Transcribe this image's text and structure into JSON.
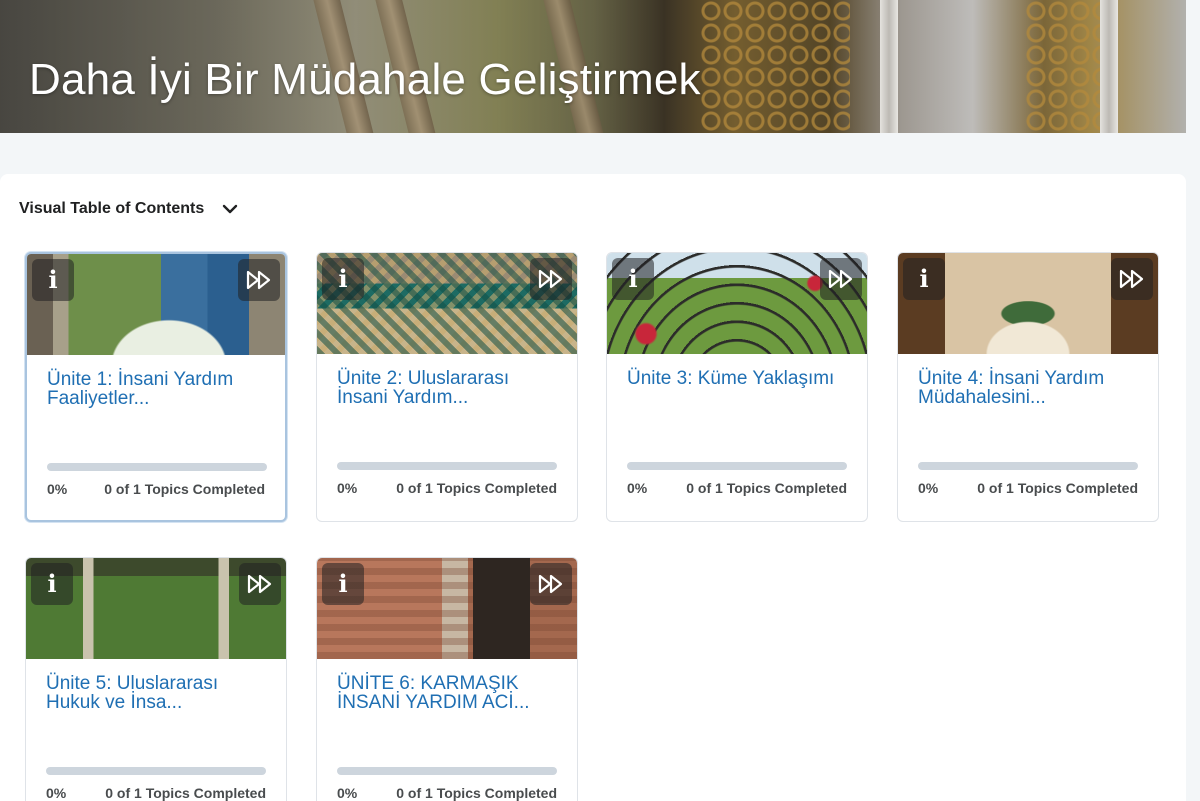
{
  "banner": {
    "title": "Daha İyi Bir Müdahale Geliştirmek"
  },
  "toc": {
    "label": "Visual Table of Contents",
    "expand_icon": "chevron-down-icon"
  },
  "cards": [
    {
      "title": "Ünite 1: İnsani Yardım Faaliyetler...",
      "progress_percent": 0,
      "percent_label": "0%",
      "topics_label": "0 of 1 Topics Completed",
      "image": "archway-tiles"
    },
    {
      "title": "Ünite 2: Uluslararası İnsani Yardım...",
      "progress_percent": 0,
      "percent_label": "0%",
      "topics_label": "0 of 1 Topics Completed",
      "image": "mosaic-wall"
    },
    {
      "title": "Ünite 3: Küme Yaklaşımı",
      "progress_percent": 0,
      "percent_label": "0%",
      "topics_label": "0 of 1 Topics Completed",
      "image": "garden-pergola"
    },
    {
      "title": "Ünite 4: İnsani Yardım Müdahalesini...",
      "progress_percent": 0,
      "percent_label": "0%",
      "topics_label": "0 of 1 Topics Completed",
      "image": "courtyard-palm"
    },
    {
      "title": "Ünite 5: Uluslararası Hukuk ve İnsa...",
      "progress_percent": 0,
      "percent_label": "0%",
      "topics_label": "0 of 1 Topics Completed",
      "image": "overgrown-colonnade"
    },
    {
      "title": "ÜNİTE 6: KARMAŞIK İNSANİ YARDIM ACİ...",
      "progress_percent": 0,
      "percent_label": "0%",
      "topics_label": "0 of 1 Topics Completed",
      "image": "stone-window"
    }
  ],
  "icons": {
    "info": "info-icon",
    "skip": "fast-forward-icon"
  },
  "colors": {
    "title_link": "#1f6fb3",
    "progress_track": "#cdd5dd",
    "focus_border": "#a9c4df"
  }
}
